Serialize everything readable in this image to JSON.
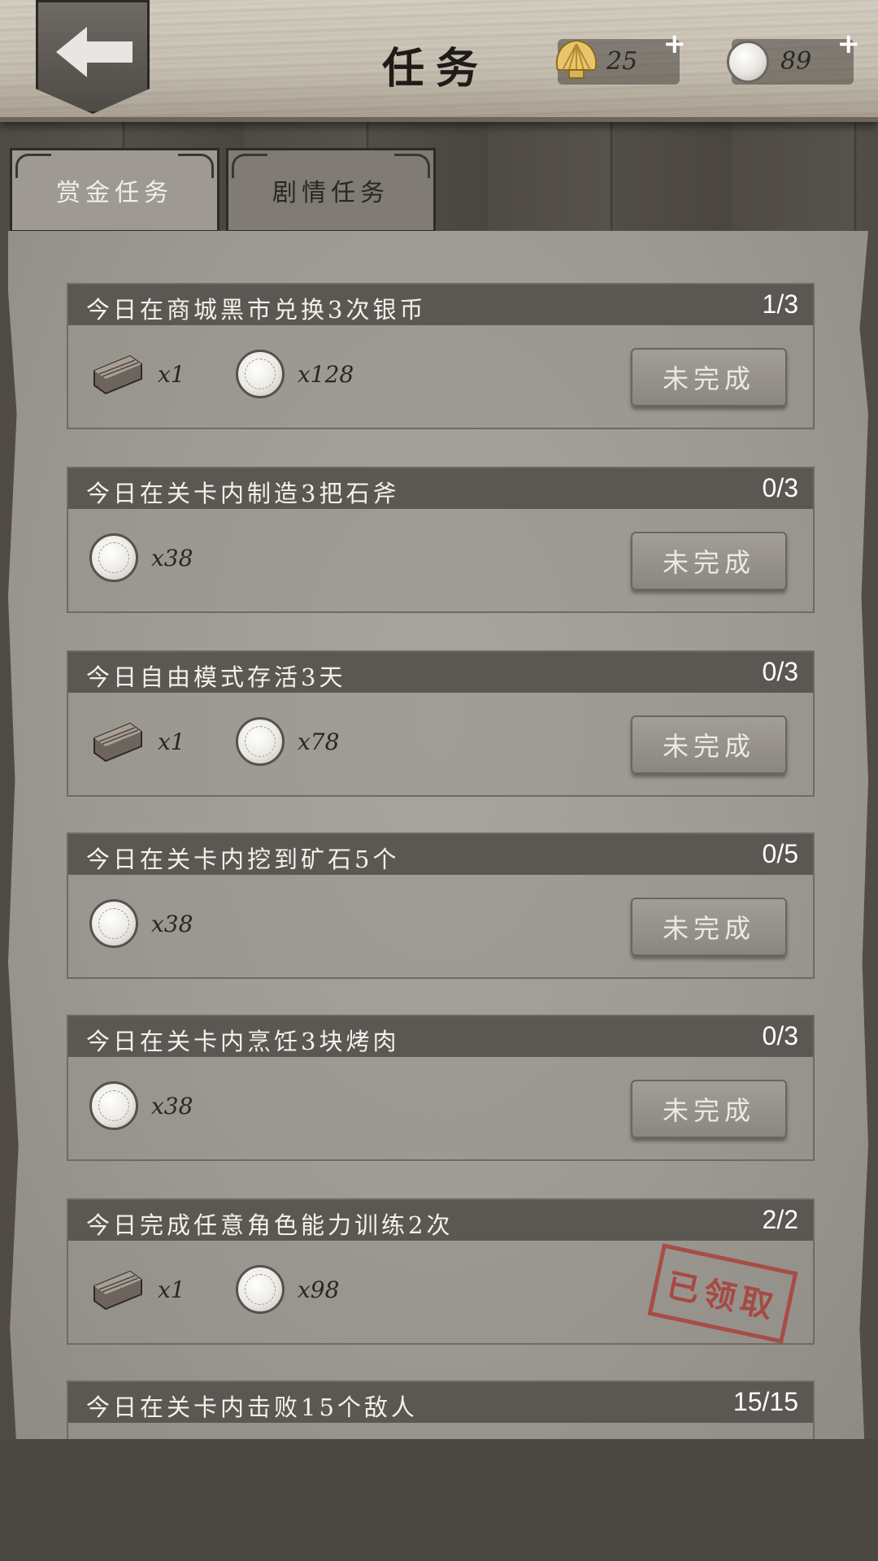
{
  "header": {
    "title": "任务",
    "shells": "25",
    "coins": "89",
    "plus": "+"
  },
  "tabs": [
    {
      "label": "赏金任务",
      "active": true
    },
    {
      "label": "剧情任务",
      "active": false
    }
  ],
  "tasks": [
    {
      "title": "今日在商城黑市兑换3次银币",
      "progress": "1/3",
      "rewards": [
        {
          "icon": "wood-icon",
          "qty": "x1"
        },
        {
          "icon": "coin-icon",
          "qty": "x128"
        }
      ],
      "status": "未完成"
    },
    {
      "title": "今日在关卡内制造3把石斧",
      "progress": "0/3",
      "rewards": [
        {
          "icon": "coin-icon",
          "qty": "x38"
        }
      ],
      "status": "未完成"
    },
    {
      "title": "今日自由模式存活3天",
      "progress": "0/3",
      "rewards": [
        {
          "icon": "wood-icon",
          "qty": "x1"
        },
        {
          "icon": "coin-icon",
          "qty": "x78"
        }
      ],
      "status": "未完成"
    },
    {
      "title": "今日在关卡内挖到矿石5个",
      "progress": "0/5",
      "rewards": [
        {
          "icon": "coin-icon",
          "qty": "x38"
        }
      ],
      "status": "未完成"
    },
    {
      "title": "今日在关卡内烹饪3块烤肉",
      "progress": "0/3",
      "rewards": [
        {
          "icon": "coin-icon",
          "qty": "x38"
        }
      ],
      "status": "未完成"
    },
    {
      "title": "今日完成任意角色能力训练2次",
      "progress": "2/2",
      "rewards": [
        {
          "icon": "wood-icon",
          "qty": "x1"
        },
        {
          "icon": "coin-icon",
          "qty": "x98"
        }
      ],
      "status": "已领取"
    },
    {
      "title": "今日在关卡内击败15个敌人",
      "progress": "15/15",
      "rewards": [],
      "status": ""
    }
  ],
  "colors": {
    "paper": "#9d9a93",
    "task_header": "#5b5752",
    "stamp": "#aa3c37"
  }
}
